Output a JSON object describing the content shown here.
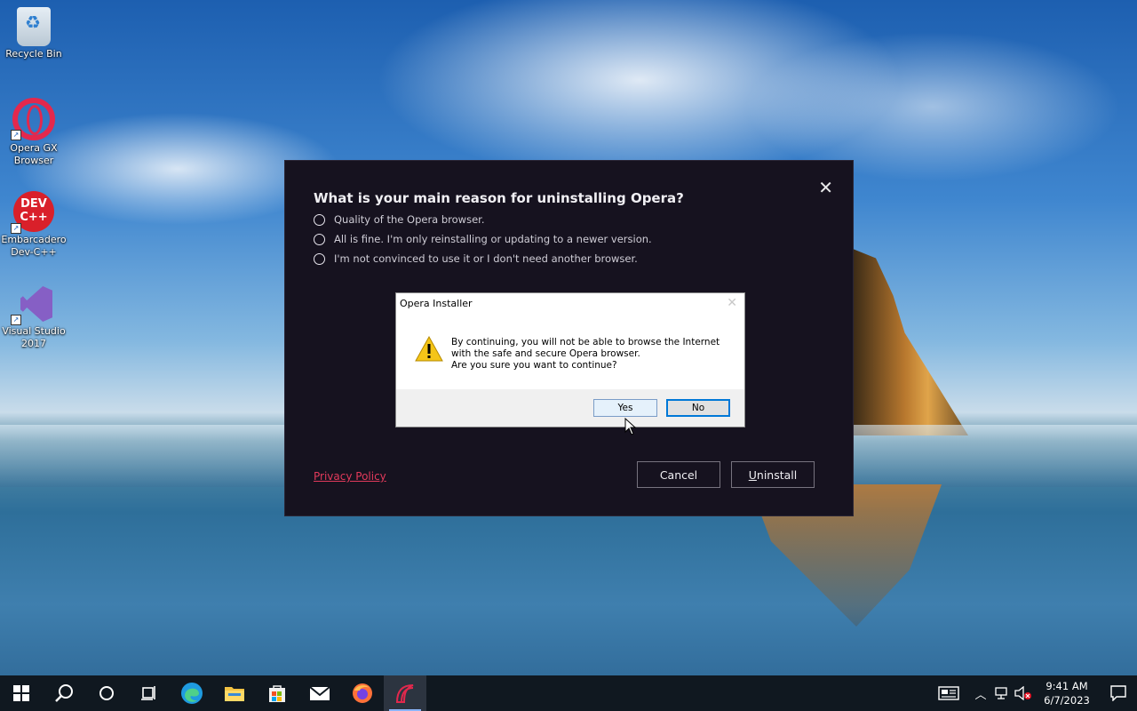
{
  "desktop": {
    "icons": [
      {
        "label_1": "Recycle Bin",
        "label_2": ""
      },
      {
        "label_1": "Opera GX",
        "label_2": "Browser"
      },
      {
        "label_1": "Embarcadero",
        "label_2": "Dev-C++"
      },
      {
        "label_1": "Visual Studio",
        "label_2": "2017"
      }
    ],
    "devcpp_badge_1": "DEV",
    "devcpp_badge_2": "C++"
  },
  "uninstall_dialog": {
    "heading": "What is your main reason for uninstalling Opera?",
    "reasons": [
      "Quality of the Opera browser.",
      "All is fine. I'm only reinstalling or updating to a newer version.",
      "I'm not convinced to use it or I don't need another browser."
    ],
    "privacy_link": "Privacy Policy",
    "cancel_label": "Cancel",
    "uninstall_label": "Uninstall",
    "close_glyph": "✕"
  },
  "message_box": {
    "title": "Opera Installer",
    "close_glyph": "✕",
    "lines": [
      "By continuing, you will not be able to browse the Internet",
      "with the safe and secure Opera browser.",
      "Are you sure you want to continue?"
    ],
    "yes_label": "Yes",
    "no_label": "No"
  },
  "taskbar": {
    "apps": [
      "start",
      "search",
      "cortana",
      "task-view",
      "edge",
      "file-explorer",
      "store",
      "mail",
      "firefox",
      "opera-installer"
    ],
    "active_app": "opera-installer",
    "clock_time": "9:41 AM",
    "clock_date": "6/7/2023"
  },
  "colors": {
    "opera_red": "#e23a5b",
    "dialog_bg": "#16121f",
    "taskbar_bg": "#101820",
    "focus_blue": "#0078d7"
  }
}
